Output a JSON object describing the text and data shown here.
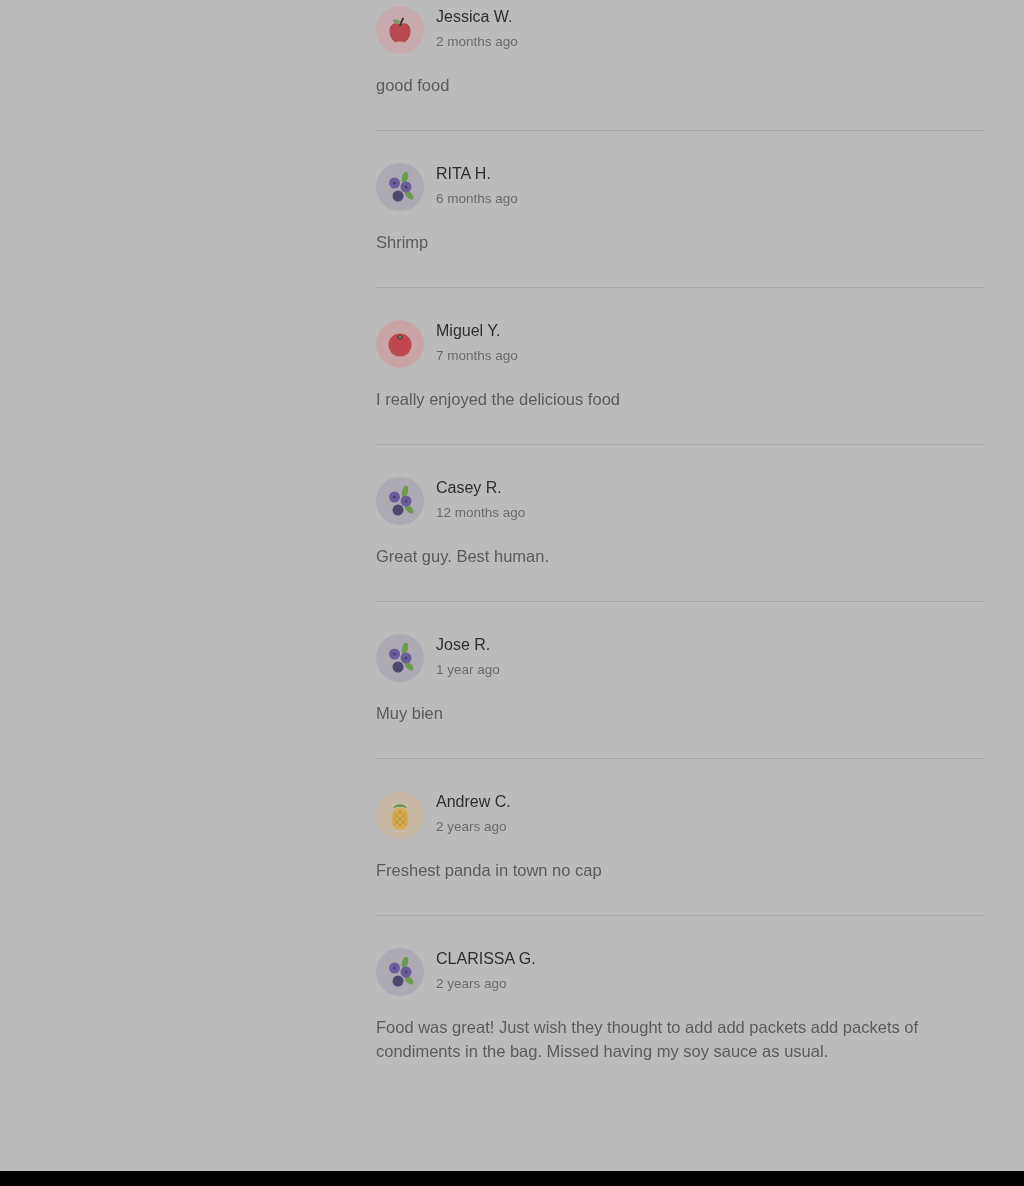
{
  "reviews": [
    {
      "avatar": {
        "kind": "apple"
      },
      "name": "Jessica W.",
      "time": "2 months ago",
      "text": "good food"
    },
    {
      "avatar": {
        "kind": "blueberry"
      },
      "name": "RITA H.",
      "time": "6 months ago",
      "text": "Shrimp"
    },
    {
      "avatar": {
        "kind": "tomato"
      },
      "name": "Miguel Y.",
      "time": "7 months ago",
      "text": "I really enjoyed the delicious food"
    },
    {
      "avatar": {
        "kind": "blueberry"
      },
      "name": "Casey R.",
      "time": "12 months ago",
      "text": "Great guy. Best human."
    },
    {
      "avatar": {
        "kind": "blueberry"
      },
      "name": "Jose R.",
      "time": "1 year ago",
      "text": "Muy bien"
    },
    {
      "avatar": {
        "kind": "pineapple"
      },
      "name": "Andrew C.",
      "time": "2 years ago",
      "text": "Freshest panda in town no cap"
    },
    {
      "avatar": {
        "kind": "blueberry"
      },
      "name": "CLARISSA G.",
      "time": "2 years ago",
      "text": "Food was great! Just wish they thought to add add packets add packets of condiments in the bag. Missed having my soy sauce as usual."
    }
  ]
}
